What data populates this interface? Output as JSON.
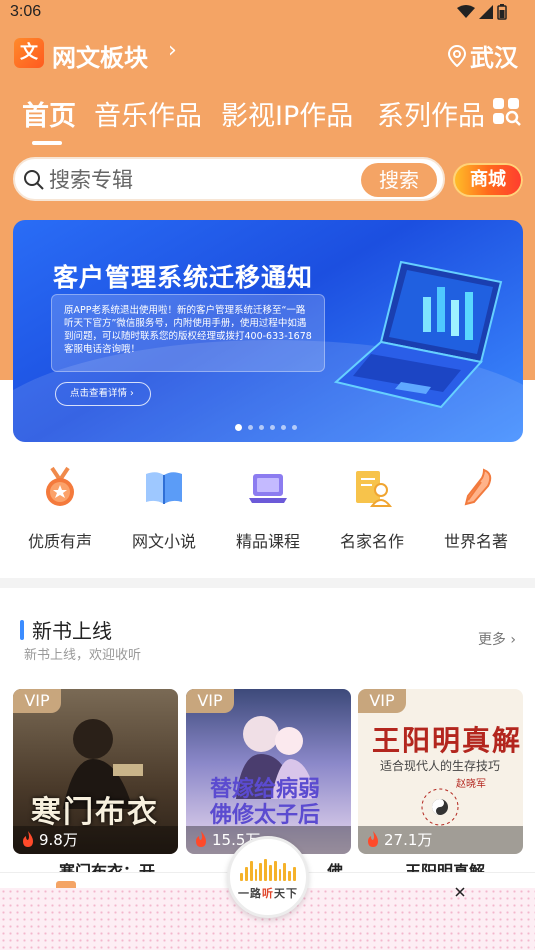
{
  "status": {
    "time": "3:06"
  },
  "header": {
    "title": "网文板块",
    "chevron": "›",
    "city": "武汉",
    "logo_char": "文"
  },
  "tabs": [
    {
      "label": "首页",
      "active": true
    },
    {
      "label": "音乐作品"
    },
    {
      "label": "影视IP作品"
    },
    {
      "label": "系列作品"
    }
  ],
  "search": {
    "placeholder": "搜索专辑",
    "button": "搜索",
    "mall_button": "商城"
  },
  "banner": {
    "title": "客户管理系统迁移通知",
    "body": "原APP老系统退出使用啦！新的客户管理系统迁移至“一路听天下官方”微信服务号，内附使用手册，使用过程中如遇到问题，可以随时联系您的版权经理或拨打400-633-1678客服电话咨询哦！",
    "button": "点击查看详情",
    "dots_total": 6,
    "dots_active": 0
  },
  "categories": [
    {
      "label": "优质有声",
      "icon": "medal-icon"
    },
    {
      "label": "网文小说",
      "icon": "book-icon"
    },
    {
      "label": "精品课程",
      "icon": "laptop-icon"
    },
    {
      "label": "名家名作",
      "icon": "author-doc-icon"
    },
    {
      "label": "世界名著",
      "icon": "quill-icon"
    }
  ],
  "section": {
    "title": "新书上线",
    "subtitle": "新书上线，欢迎收听",
    "more": "更多 ›"
  },
  "books": [
    {
      "badge": "VIP",
      "plays": "9.8万",
      "cover_title": "寒门布衣",
      "title": "寒门布衣：开..."
    },
    {
      "badge": "VIP",
      "plays": "15.5万",
      "cover_title": "替嫁给病弱佛修太子后",
      "title": "...佛"
    },
    {
      "badge": "VIP",
      "plays": "27.1万",
      "cover_title": "王阳明真解",
      "cover_subtitle": "适合现代人的生存技巧",
      "cover_author": "赵晓军",
      "title": "王阳明真解"
    }
  ],
  "fab": {
    "label_a": "一路",
    "label_b": "听",
    "label_c": "天下"
  },
  "colors": {
    "primary": "#f4a465",
    "accent_blue": "#3b8cff",
    "vip_gold": "#c8a67d"
  }
}
